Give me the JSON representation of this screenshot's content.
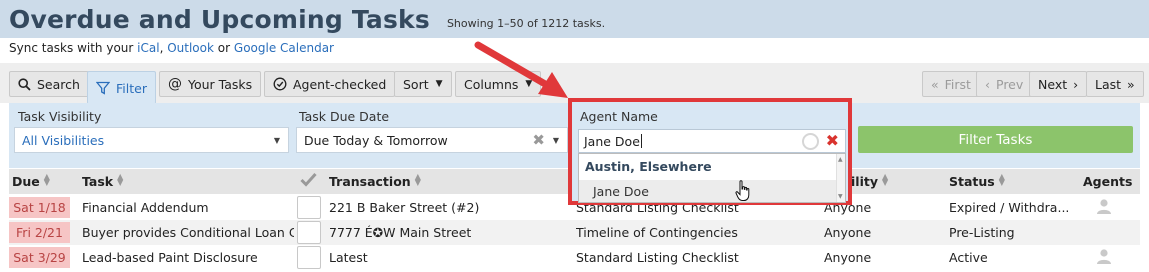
{
  "header": {
    "title": "Overdue and Upcoming Tasks",
    "count": "Showing 1–50 of 1212 tasks."
  },
  "sync": {
    "prefix": "Sync tasks with your",
    "ical": "iCal",
    "sep1": ",",
    "outlook": "Outlook",
    "or": "or",
    "google": "Google Calendar"
  },
  "toolbar": {
    "search": "Search",
    "filter": "Filter",
    "your_tasks": "Your Tasks",
    "agent_checked": "Agent-checked",
    "sort": "Sort",
    "columns": "Columns",
    "first": "First",
    "prev": "Prev",
    "next": "Next",
    "last": "Last"
  },
  "filters": {
    "task_visibility": {
      "label": "Task Visibility",
      "value": "All Visibilities"
    },
    "task_due_date": {
      "label": "Task Due Date",
      "value": "Due Today & Tomorrow"
    },
    "agent_name": {
      "label": "Agent Name",
      "input_value": "Jane Doe",
      "group": "Austin, Elsewhere",
      "option": "Jane Doe"
    },
    "submit_label": "Filter Tasks"
  },
  "table": {
    "headers": {
      "due": "Due",
      "task": "Task",
      "transaction": "Transaction",
      "checklist_partial": "",
      "visibility_partial": "ility",
      "status": "Status",
      "agents": "Agents"
    },
    "rows": [
      {
        "due": "Sat 1/18",
        "task": "Financial Addendum",
        "transaction": "221 B Baker Street (#2)",
        "checklist": "Standard Listing Checklist",
        "visibility": "Anyone",
        "status": "Expired / Withdra..."
      },
      {
        "due": "Fri 2/21",
        "task": "Buyer provides Conditional Loan C...",
        "transaction": "7777 É✪W Main Street",
        "checklist": "Timeline of Contingencies",
        "visibility": "Anyone",
        "status": "Pre-Listing"
      },
      {
        "due": "Sat 3/29",
        "task": "Lead-based Paint Disclosure",
        "transaction": "Latest",
        "checklist": "Standard Listing Checklist",
        "visibility": "Anyone",
        "status": "Active"
      }
    ]
  },
  "colors": {
    "header_bg": "#ccdbe9",
    "title": "#34495e",
    "link": "#2a6ebb",
    "filter_bg": "#d8e7f4",
    "filter_button": "#8cc46b",
    "overdue_bg": "#f6c5c5",
    "overdue_text": "#b84444",
    "highlight": "#e0383a"
  }
}
